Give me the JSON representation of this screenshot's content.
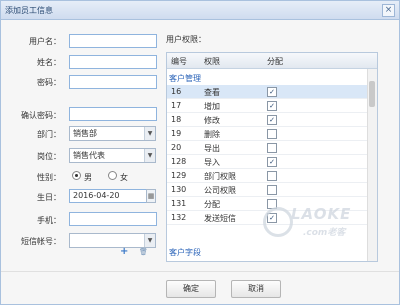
{
  "dialog": {
    "title": "添加员工信息",
    "close_glyph": "×"
  },
  "form": {
    "username": {
      "label": "用户名：",
      "value": ""
    },
    "name": {
      "label": "姓名：",
      "value": ""
    },
    "password": {
      "label": "密码：",
      "value": ""
    },
    "confirm": {
      "label": "确认密码：",
      "value": ""
    },
    "department": {
      "label": "部门：",
      "value": "销售部"
    },
    "position": {
      "label": "岗位：",
      "value": "销售代表"
    },
    "gender": {
      "label": "性别：",
      "male": "男",
      "female": "女",
      "selected": "男"
    },
    "birthday": {
      "label": "生日：",
      "value": "2016-04-20"
    },
    "phone": {
      "label": "手机：",
      "value": ""
    },
    "sms": {
      "label": "短信帐号：",
      "value": ""
    }
  },
  "permissions": {
    "label": "用户权限：",
    "columns": [
      "编号",
      "权限",
      "分配"
    ],
    "group1": "客户管理",
    "group2": "客户字段",
    "rows": [
      {
        "id": "16",
        "name": "查看",
        "checked": true
      },
      {
        "id": "17",
        "name": "增加",
        "checked": true
      },
      {
        "id": "18",
        "name": "修改",
        "checked": true
      },
      {
        "id": "19",
        "name": "删除",
        "checked": false
      },
      {
        "id": "20",
        "name": "导出",
        "checked": false
      },
      {
        "id": "128",
        "name": "导入",
        "checked": true
      },
      {
        "id": "129",
        "name": "部门权限",
        "checked": false
      },
      {
        "id": "130",
        "name": "公司权限",
        "checked": false
      },
      {
        "id": "131",
        "name": "分配",
        "checked": false
      },
      {
        "id": "132",
        "name": "发送短信",
        "checked": true
      }
    ]
  },
  "watermark": {
    "brand": "LAOKE",
    "sub": ".com老客"
  },
  "buttons": {
    "ok": "确定",
    "cancel": "取消"
  },
  "icons": {
    "add": "+",
    "delete": "🗑",
    "calendar": "▦",
    "dropdown": "▼"
  }
}
